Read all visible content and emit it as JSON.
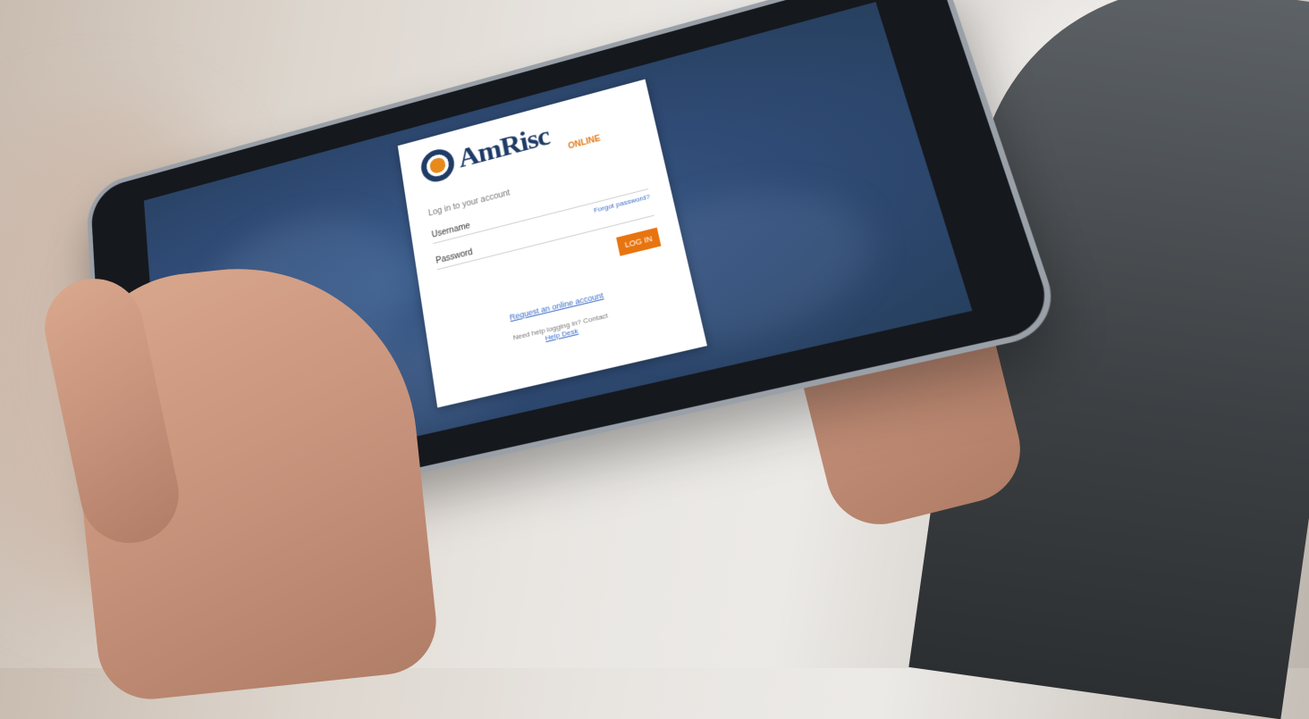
{
  "login": {
    "brand": "AmRisc",
    "brand_sub": "ONLINE",
    "prompt": "Log in to your account",
    "username_placeholder": "Username",
    "password_placeholder": "Password",
    "forgot": "Forgot password?",
    "login_button": "LOG IN",
    "register_link": "Request an online account",
    "contact_text": "Need help logging in? Contact",
    "contact_link": "Help Desk"
  },
  "colors": {
    "screen_bg": "#2f4a74",
    "accent": "#e8740f",
    "brand": "#1f3b66",
    "link": "#3a6bc9"
  },
  "icons": [
    "amrisc-logo-emblem"
  ]
}
